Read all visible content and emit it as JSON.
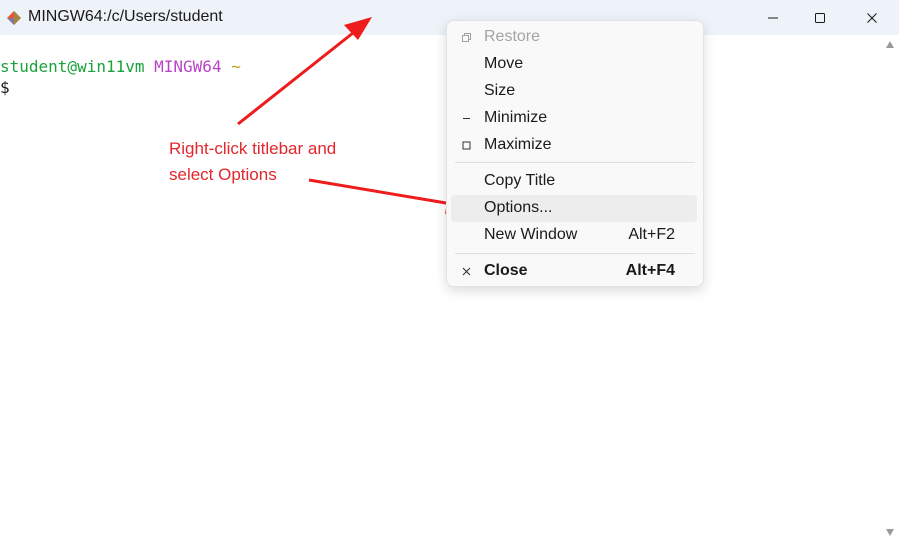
{
  "window": {
    "title": "MINGW64:/c/Users/student",
    "app_icon": "git-bash-icon",
    "controls": {
      "minimize": "minimize-icon",
      "maximize": "maximize-icon",
      "close": "close-icon"
    }
  },
  "terminal": {
    "user_host": "student@win11vm",
    "system": "MINGW64",
    "cwd": "~",
    "prompt": "$",
    "colors": {
      "user_host": "#1aa33a",
      "system": "#b845c8",
      "cwd": "#b8a21a"
    }
  },
  "annotation": {
    "line1": "Right-click titlebar and",
    "line2": "select Options",
    "color": "#e3262b"
  },
  "context_menu": {
    "items": [
      {
        "label": "Restore",
        "shortcut": "",
        "icon": "restore-icon",
        "state": "disabled"
      },
      {
        "label": "Move",
        "shortcut": "",
        "icon": "",
        "state": "normal"
      },
      {
        "label": "Size",
        "shortcut": "",
        "icon": "",
        "state": "normal"
      },
      {
        "label": "Minimize",
        "shortcut": "",
        "icon": "minimize-icon",
        "state": "normal"
      },
      {
        "label": "Maximize",
        "shortcut": "",
        "icon": "maximize-icon",
        "state": "normal"
      },
      {
        "label": "Copy Title",
        "shortcut": "",
        "icon": "",
        "state": "normal"
      },
      {
        "label": "Options...",
        "shortcut": "",
        "icon": "",
        "state": "highlighted"
      },
      {
        "label": "New Window",
        "shortcut": "Alt+F2",
        "icon": "",
        "state": "normal"
      },
      {
        "label": "Close",
        "shortcut": "Alt+F4",
        "icon": "close-icon",
        "state": "bold"
      }
    ]
  }
}
